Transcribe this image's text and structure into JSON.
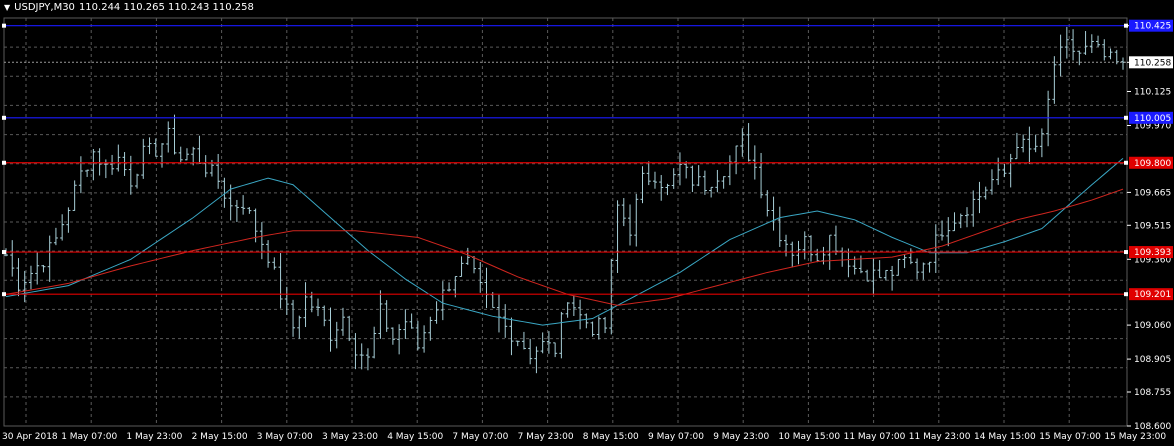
{
  "header": {
    "symbol_label": "USDJPY,M30",
    "ohlc": "110.244 110.265 110.243 110.258"
  },
  "colors": {
    "background": "#000000",
    "grid": "#5a5a5a",
    "bars": "#a8cfd8",
    "axis_text": "#ffffff",
    "ma_fast": "#3aa7c4",
    "ma_slow": "#d0261f",
    "blue_level": "#1a1aff",
    "red_level": "#e00000",
    "current_price_tag": "#ffffff"
  },
  "chart_data": {
    "type": "ohlc",
    "title": "USDJPY,M30",
    "ylim": [
      108.6,
      110.46
    ],
    "y_ticks": [
      "110.425",
      "110.258",
      "110.125",
      "109.970",
      "109.665",
      "109.515",
      "109.360",
      "109.060",
      "108.905",
      "108.755",
      "108.600"
    ],
    "x_ticks": [
      "30 Apr 2018",
      "1 May 07:00",
      "1 May 23:00",
      "2 May 15:00",
      "3 May 07:00",
      "3 May 23:00",
      "4 May 15:00",
      "7 May 07:00",
      "7 May 23:00",
      "8 May 15:00",
      "9 May 07:00",
      "9 May 23:00",
      "10 May 15:00",
      "11 May 07:00",
      "11 May 23:00",
      "14 May 15:00",
      "15 May 07:00",
      "15 May 23:00"
    ],
    "current_price": "110.258",
    "horizontal_levels": [
      {
        "price": 110.425,
        "color": "blue",
        "label": "110.425"
      },
      {
        "price": 110.005,
        "color": "blue",
        "label": "110.005"
      },
      {
        "price": 109.8,
        "color": "red",
        "label": "109.800"
      },
      {
        "price": 109.393,
        "color": "red",
        "label": "109.393"
      },
      {
        "price": 109.201,
        "color": "red",
        "label": "109.201"
      }
    ],
    "close_path": [
      [
        0,
        109.38
      ],
      [
        2,
        109.25
      ],
      [
        4,
        109.3
      ],
      [
        6,
        109.36
      ],
      [
        8,
        109.45
      ],
      [
        10,
        109.6
      ],
      [
        12,
        109.75
      ],
      [
        14,
        109.85
      ],
      [
        16,
        109.78
      ],
      [
        18,
        109.82
      ],
      [
        20,
        109.72
      ],
      [
        22,
        109.84
      ],
      [
        24,
        109.86
      ],
      [
        26,
        109.92
      ],
      [
        28,
        109.82
      ],
      [
        30,
        109.85
      ],
      [
        32,
        109.78
      ],
      [
        34,
        109.72
      ],
      [
        36,
        109.6
      ],
      [
        38,
        109.62
      ],
      [
        40,
        109.5
      ],
      [
        42,
        109.38
      ],
      [
        44,
        109.2
      ],
      [
        46,
        109.05
      ],
      [
        48,
        109.18
      ],
      [
        50,
        109.12
      ],
      [
        52,
        109.02
      ],
      [
        54,
        109.1
      ],
      [
        56,
        108.96
      ],
      [
        58,
        108.9
      ],
      [
        60,
        109.12
      ],
      [
        62,
        109.0
      ],
      [
        64,
        109.08
      ],
      [
        66,
        108.96
      ],
      [
        68,
        109.1
      ],
      [
        70,
        109.2
      ],
      [
        72,
        109.3
      ],
      [
        74,
        109.34
      ],
      [
        76,
        109.22
      ],
      [
        78,
        109.12
      ],
      [
        80,
        109.05
      ],
      [
        82,
        109.0
      ],
      [
        84,
        108.93
      ],
      [
        86,
        108.97
      ],
      [
        88,
        108.95
      ],
      [
        90,
        109.2
      ],
      [
        92,
        109.1
      ],
      [
        94,
        109.05
      ],
      [
        96,
        109.05
      ],
      [
        98,
        109.6
      ],
      [
        100,
        109.5
      ],
      [
        102,
        109.72
      ],
      [
        104,
        109.75
      ],
      [
        106,
        109.68
      ],
      [
        108,
        109.78
      ],
      [
        110,
        109.72
      ],
      [
        112,
        109.7
      ],
      [
        114,
        109.75
      ],
      [
        116,
        109.8
      ],
      [
        118,
        109.9
      ],
      [
        120,
        109.78
      ],
      [
        122,
        109.6
      ],
      [
        124,
        109.48
      ],
      [
        126,
        109.4
      ],
      [
        128,
        109.44
      ],
      [
        130,
        109.38
      ],
      [
        132,
        109.46
      ],
      [
        134,
        109.4
      ],
      [
        136,
        109.32
      ],
      [
        138,
        109.3
      ],
      [
        140,
        109.28
      ],
      [
        142,
        109.3
      ],
      [
        144,
        109.35
      ],
      [
        146,
        109.32
      ],
      [
        148,
        109.38
      ],
      [
        150,
        109.5
      ],
      [
        152,
        109.55
      ],
      [
        154,
        109.6
      ],
      [
        156,
        109.65
      ],
      [
        158,
        109.72
      ],
      [
        160,
        109.75
      ],
      [
        162,
        109.9
      ],
      [
        164,
        109.85
      ],
      [
        166,
        109.9
      ],
      [
        168,
        110.25
      ],
      [
        170,
        110.33
      ],
      [
        172,
        110.3
      ],
      [
        174,
        110.33
      ],
      [
        176,
        110.28
      ],
      [
        178,
        110.25
      ],
      [
        179,
        110.258
      ]
    ],
    "ma_fast_path": [
      [
        0,
        109.19
      ],
      [
        10,
        109.24
      ],
      [
        20,
        109.36
      ],
      [
        30,
        109.55
      ],
      [
        36,
        109.68
      ],
      [
        42,
        109.73
      ],
      [
        46,
        109.7
      ],
      [
        52,
        109.55
      ],
      [
        58,
        109.4
      ],
      [
        64,
        109.27
      ],
      [
        70,
        109.16
      ],
      [
        78,
        109.1
      ],
      [
        86,
        109.06
      ],
      [
        94,
        109.09
      ],
      [
        100,
        109.18
      ],
      [
        108,
        109.3
      ],
      [
        116,
        109.45
      ],
      [
        124,
        109.55
      ],
      [
        130,
        109.58
      ],
      [
        136,
        109.54
      ],
      [
        142,
        109.46
      ],
      [
        148,
        109.39
      ],
      [
        154,
        109.39
      ],
      [
        160,
        109.44
      ],
      [
        166,
        109.5
      ],
      [
        170,
        109.6
      ],
      [
        174,
        109.7
      ],
      [
        179,
        109.82
      ]
    ],
    "ma_slow_path": [
      [
        0,
        109.2
      ],
      [
        10,
        109.25
      ],
      [
        20,
        109.33
      ],
      [
        30,
        109.4
      ],
      [
        40,
        109.46
      ],
      [
        46,
        109.49
      ],
      [
        56,
        109.49
      ],
      [
        66,
        109.46
      ],
      [
        74,
        109.38
      ],
      [
        82,
        109.28
      ],
      [
        90,
        109.2
      ],
      [
        98,
        109.15
      ],
      [
        106,
        109.18
      ],
      [
        114,
        109.24
      ],
      [
        122,
        109.3
      ],
      [
        130,
        109.35
      ],
      [
        136,
        109.36
      ],
      [
        142,
        109.37
      ],
      [
        150,
        109.42
      ],
      [
        156,
        109.48
      ],
      [
        162,
        109.54
      ],
      [
        168,
        109.58
      ],
      [
        174,
        109.63
      ],
      [
        179,
        109.68
      ]
    ],
    "bar_count": 180
  }
}
